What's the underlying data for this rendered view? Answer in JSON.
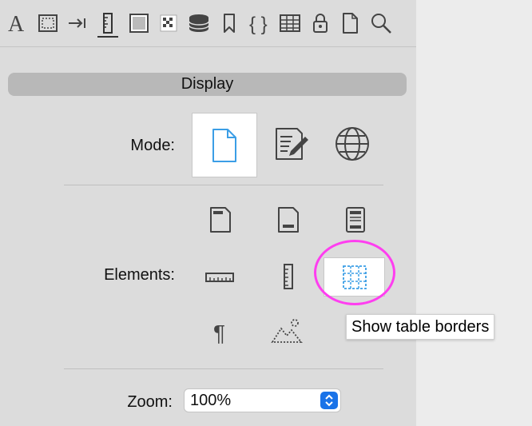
{
  "toolbar": {
    "items": [
      {
        "name": "font"
      },
      {
        "name": "border"
      },
      {
        "name": "indent"
      },
      {
        "name": "ruler",
        "active": true
      },
      {
        "name": "frame"
      },
      {
        "name": "pattern"
      },
      {
        "name": "database"
      },
      {
        "name": "bookmark"
      },
      {
        "name": "code-braces"
      },
      {
        "name": "table"
      },
      {
        "name": "lock"
      },
      {
        "name": "page"
      },
      {
        "name": "search"
      }
    ]
  },
  "section": {
    "title": "Display"
  },
  "mode": {
    "label": "Mode:",
    "options": [
      {
        "name": "page-mode",
        "icon": "document-icon",
        "selected": true
      },
      {
        "name": "edit-mode",
        "icon": "edit-document-icon",
        "selected": false
      },
      {
        "name": "web-mode",
        "icon": "globe-icon",
        "selected": false
      }
    ]
  },
  "elements": {
    "label": "Elements:",
    "buttons": [
      {
        "name": "header",
        "icon": "page-header-icon"
      },
      {
        "name": "footer",
        "icon": "page-footer-icon"
      },
      {
        "name": "header-footer",
        "icon": "header-footer-icon"
      },
      {
        "name": "horizontal-ruler",
        "icon": "horizontal-ruler-icon"
      },
      {
        "name": "vertical-ruler",
        "icon": "vertical-ruler-icon"
      },
      {
        "name": "table-borders",
        "icon": "table-borders-icon",
        "selected": true
      },
      {
        "name": "paragraph-marks",
        "icon": "pilcrow-icon"
      },
      {
        "name": "image-placeholders",
        "icon": "image-placeholder-icon"
      }
    ]
  },
  "zoom": {
    "label": "Zoom:",
    "value": "100%"
  },
  "tooltip": {
    "text": "Show table borders"
  },
  "colors": {
    "accent": "#1a73e8",
    "highlight": "#ff3ef0",
    "icon_selected": "#3b9ee6",
    "icon": "#444444"
  }
}
